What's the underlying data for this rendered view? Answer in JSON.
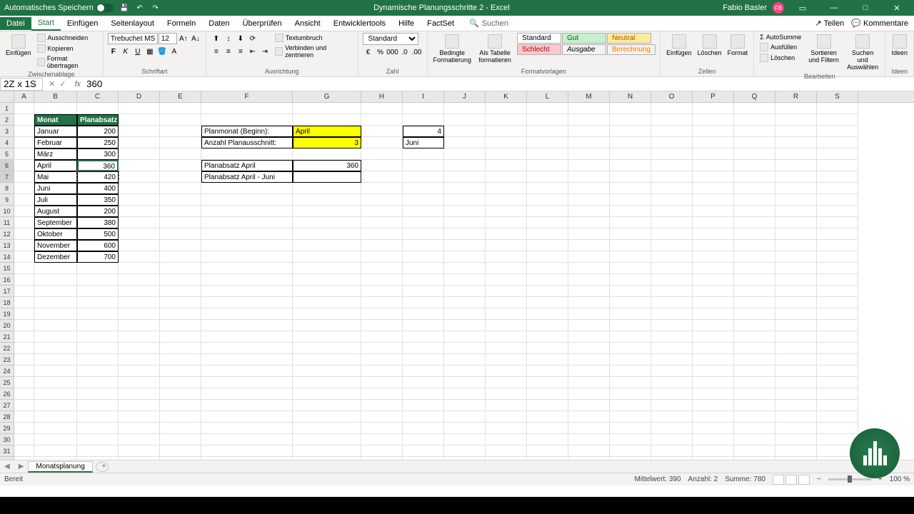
{
  "titlebar": {
    "autosave": "Automatisches Speichern",
    "title": "Dynamische Planungsschritte 2 - Excel",
    "user": "Fabio Basler",
    "user_initial": "FB"
  },
  "menu": {
    "file": "Datei",
    "start": "Start",
    "einfugen": "Einfügen",
    "seitenlayout": "Seitenlayout",
    "formeln": "Formeln",
    "daten": "Daten",
    "uberprufen": "Überprüfen",
    "ansicht": "Ansicht",
    "entwicklertools": "Entwicklertools",
    "hilfe": "Hilfe",
    "factset": "FactSet",
    "suchen": "Suchen",
    "teilen": "Teilen",
    "kommentare": "Kommentare"
  },
  "ribbon": {
    "einfugen_btn": "Einfügen",
    "ausschneiden": "Ausschneiden",
    "kopieren": "Kopieren",
    "format_ubertragen": "Format übertragen",
    "zwischenablage": "Zwischenablage",
    "font_name": "Trebuchet MS",
    "font_size": "12",
    "schriftart": "Schriftart",
    "textumbruch": "Textumbruch",
    "verbinden": "Verbinden und zentrieren",
    "ausrichtung": "Ausrichtung",
    "num_format": "Standard",
    "zahl": "Zahl",
    "bedingte": "Bedingte Formatierung",
    "als_tabelle": "Als Tabelle formatieren",
    "standard": "Standard",
    "gut": "Gut",
    "neutral": "Neutral",
    "schlecht": "Schlecht",
    "ausgabe": "Ausgabe",
    "berechnung": "Berechnung",
    "formatvorlagen": "Formatvorlagen",
    "einfugen_cell": "Einfügen",
    "loschen": "Löschen",
    "format": "Format",
    "zellen": "Zellen",
    "autosumme": "AutoSumme",
    "ausfullen": "Ausfüllen",
    "loschen2": "Löschen",
    "sortieren": "Sortieren und Filtern",
    "suchen_aus": "Suchen und Auswählen",
    "bearbeiten": "Bearbeiten",
    "ideen": "Ideen"
  },
  "formula": {
    "name_box": "2Z x 1S",
    "value": "360"
  },
  "columns": [
    "A",
    "B",
    "C",
    "D",
    "E",
    "F",
    "G",
    "H",
    "I",
    "J",
    "K",
    "L",
    "M",
    "N",
    "O",
    "P",
    "Q",
    "R",
    "S"
  ],
  "table": {
    "header_monat": "Monat",
    "header_planabsatz": "Planabsatz",
    "rows": [
      {
        "month": "Januar",
        "val": "200"
      },
      {
        "month": "Februar",
        "val": "250"
      },
      {
        "month": "März",
        "val": "300"
      },
      {
        "month": "April",
        "val": "360"
      },
      {
        "month": "Mai",
        "val": "420"
      },
      {
        "month": "Juni",
        "val": "400"
      },
      {
        "month": "Juli",
        "val": "350"
      },
      {
        "month": "August",
        "val": "200"
      },
      {
        "month": "September",
        "val": "380"
      },
      {
        "month": "Oktober",
        "val": "500"
      },
      {
        "month": "November",
        "val": "600"
      },
      {
        "month": "Dezember",
        "val": "700"
      }
    ]
  },
  "plan": {
    "planmonat_label": "Planmonat (Beginn):",
    "planmonat_val": "April",
    "anzahl_label": "Anzahl Planausschnitt:",
    "anzahl_val": "3",
    "planabsatz_april_label": "Planabsatz April",
    "planabsatz_april_val": "360",
    "planabsatz_range_label": "Planabsatz April - Juni",
    "i3": "4",
    "i4": "Juni"
  },
  "sheet": {
    "tab": "Monatsplanung"
  },
  "status": {
    "bereit": "Bereit",
    "mittelwert": "Mittelwert: 390",
    "anzahl": "Anzahl: 2",
    "summe": "Summe: 780",
    "zoom": "100 %"
  }
}
